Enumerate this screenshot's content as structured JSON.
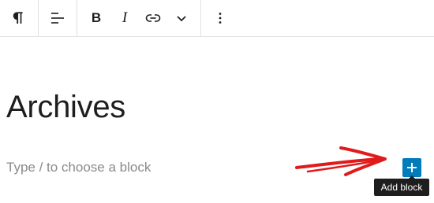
{
  "toolbar": {
    "groups": [
      {
        "buttons": [
          {
            "icon": "paragraph-icon"
          }
        ]
      },
      {
        "buttons": [
          {
            "icon": "align-left-icon"
          }
        ]
      },
      {
        "buttons": [
          {
            "icon": "bold-icon",
            "label": "B"
          },
          {
            "icon": "italic-icon",
            "label": "I"
          },
          {
            "icon": "link-icon"
          },
          {
            "icon": "chevron-down-icon"
          }
        ]
      },
      {
        "buttons": [
          {
            "icon": "more-vertical-icon"
          }
        ]
      }
    ]
  },
  "editor": {
    "heading": "Archives",
    "placeholder": "Type / to choose a block"
  },
  "add_block": {
    "icon": "plus-icon",
    "tooltip": "Add block"
  },
  "annotation": {
    "icon": "red-arrow-icon",
    "color": "#e01b1b"
  },
  "colors": {
    "accent": "#007cba",
    "text": "#1e1e1e",
    "placeholder": "#8a8a8a",
    "divider": "#e0e0e0"
  }
}
